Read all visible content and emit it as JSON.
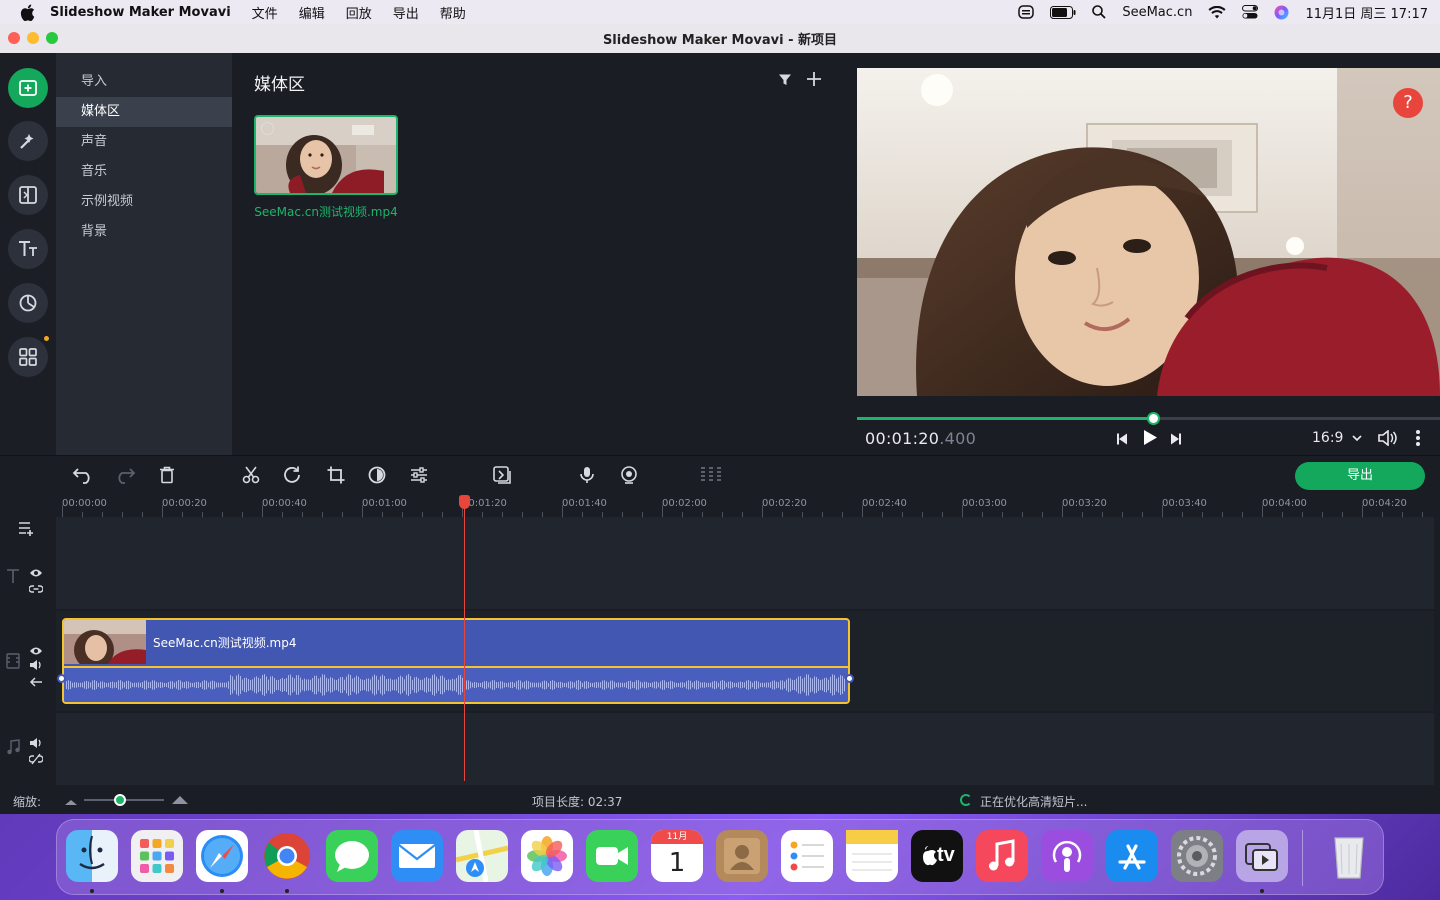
{
  "menubar": {
    "app_name": "Slideshow Maker Movavi",
    "menus": [
      "文件",
      "编辑",
      "回放",
      "导出",
      "帮助"
    ],
    "site": "SeeMac.cn",
    "clock": "11月1日 周三  17:17"
  },
  "window": {
    "title": "Slideshow Maker Movavi - 新项目"
  },
  "sidebar": {
    "categories": [
      {
        "label": "导入",
        "selected": false
      },
      {
        "label": "媒体区",
        "selected": true
      },
      {
        "label": "声音",
        "selected": false
      },
      {
        "label": "音乐",
        "selected": false
      },
      {
        "label": "示例视频",
        "selected": false
      },
      {
        "label": "背景",
        "selected": false
      }
    ]
  },
  "media": {
    "title": "媒体区",
    "items": [
      {
        "name": "SeeMac.cn测试视频.mp4"
      }
    ]
  },
  "preview": {
    "help_label": "?",
    "timecode_main": "00:01:20",
    "timecode_ms": ".400",
    "progress": 0.508,
    "aspect": "16:9"
  },
  "toolbar": {
    "export_label": "导出"
  },
  "timeline": {
    "ruler_labels": [
      "00:00:00",
      "00:00:20",
      "00:00:40",
      "00:01:00",
      "00:01:20",
      "00:01:40",
      "00:02:00",
      "00:02:20",
      "00:02:40",
      "00:03:00",
      "00:03:20",
      "00:03:40",
      "00:04:00",
      "00:04:20"
    ],
    "clip_name": "SeeMac.cn测试视频.mp4"
  },
  "status": {
    "zoom_label": "缩放:",
    "zoom_level": 0.45,
    "project_length": "项目长度:  02:37",
    "optimizing": "正在优化高清短片..."
  },
  "colors": {
    "accent_green": "#14a85c",
    "playhead_red": "#e8453c",
    "clip_blue": "#4257b2",
    "clip_border_yellow": "#f4c430"
  },
  "dock": {
    "apps": [
      "finder-icon",
      "launchpad-icon",
      "safari-icon",
      "chrome-icon",
      "messages-icon",
      "mail-icon",
      "maps-icon",
      "photos-icon",
      "facetime-icon",
      "calendar-icon",
      "contacts-icon",
      "reminders-icon",
      "notes-icon",
      "tv-icon",
      "music-icon",
      "podcasts-icon",
      "app-store-icon",
      "system-preferences-icon",
      "movavi-icon"
    ],
    "calendar_month": "11月",
    "calendar_day": "1",
    "tv_label": "tv"
  }
}
